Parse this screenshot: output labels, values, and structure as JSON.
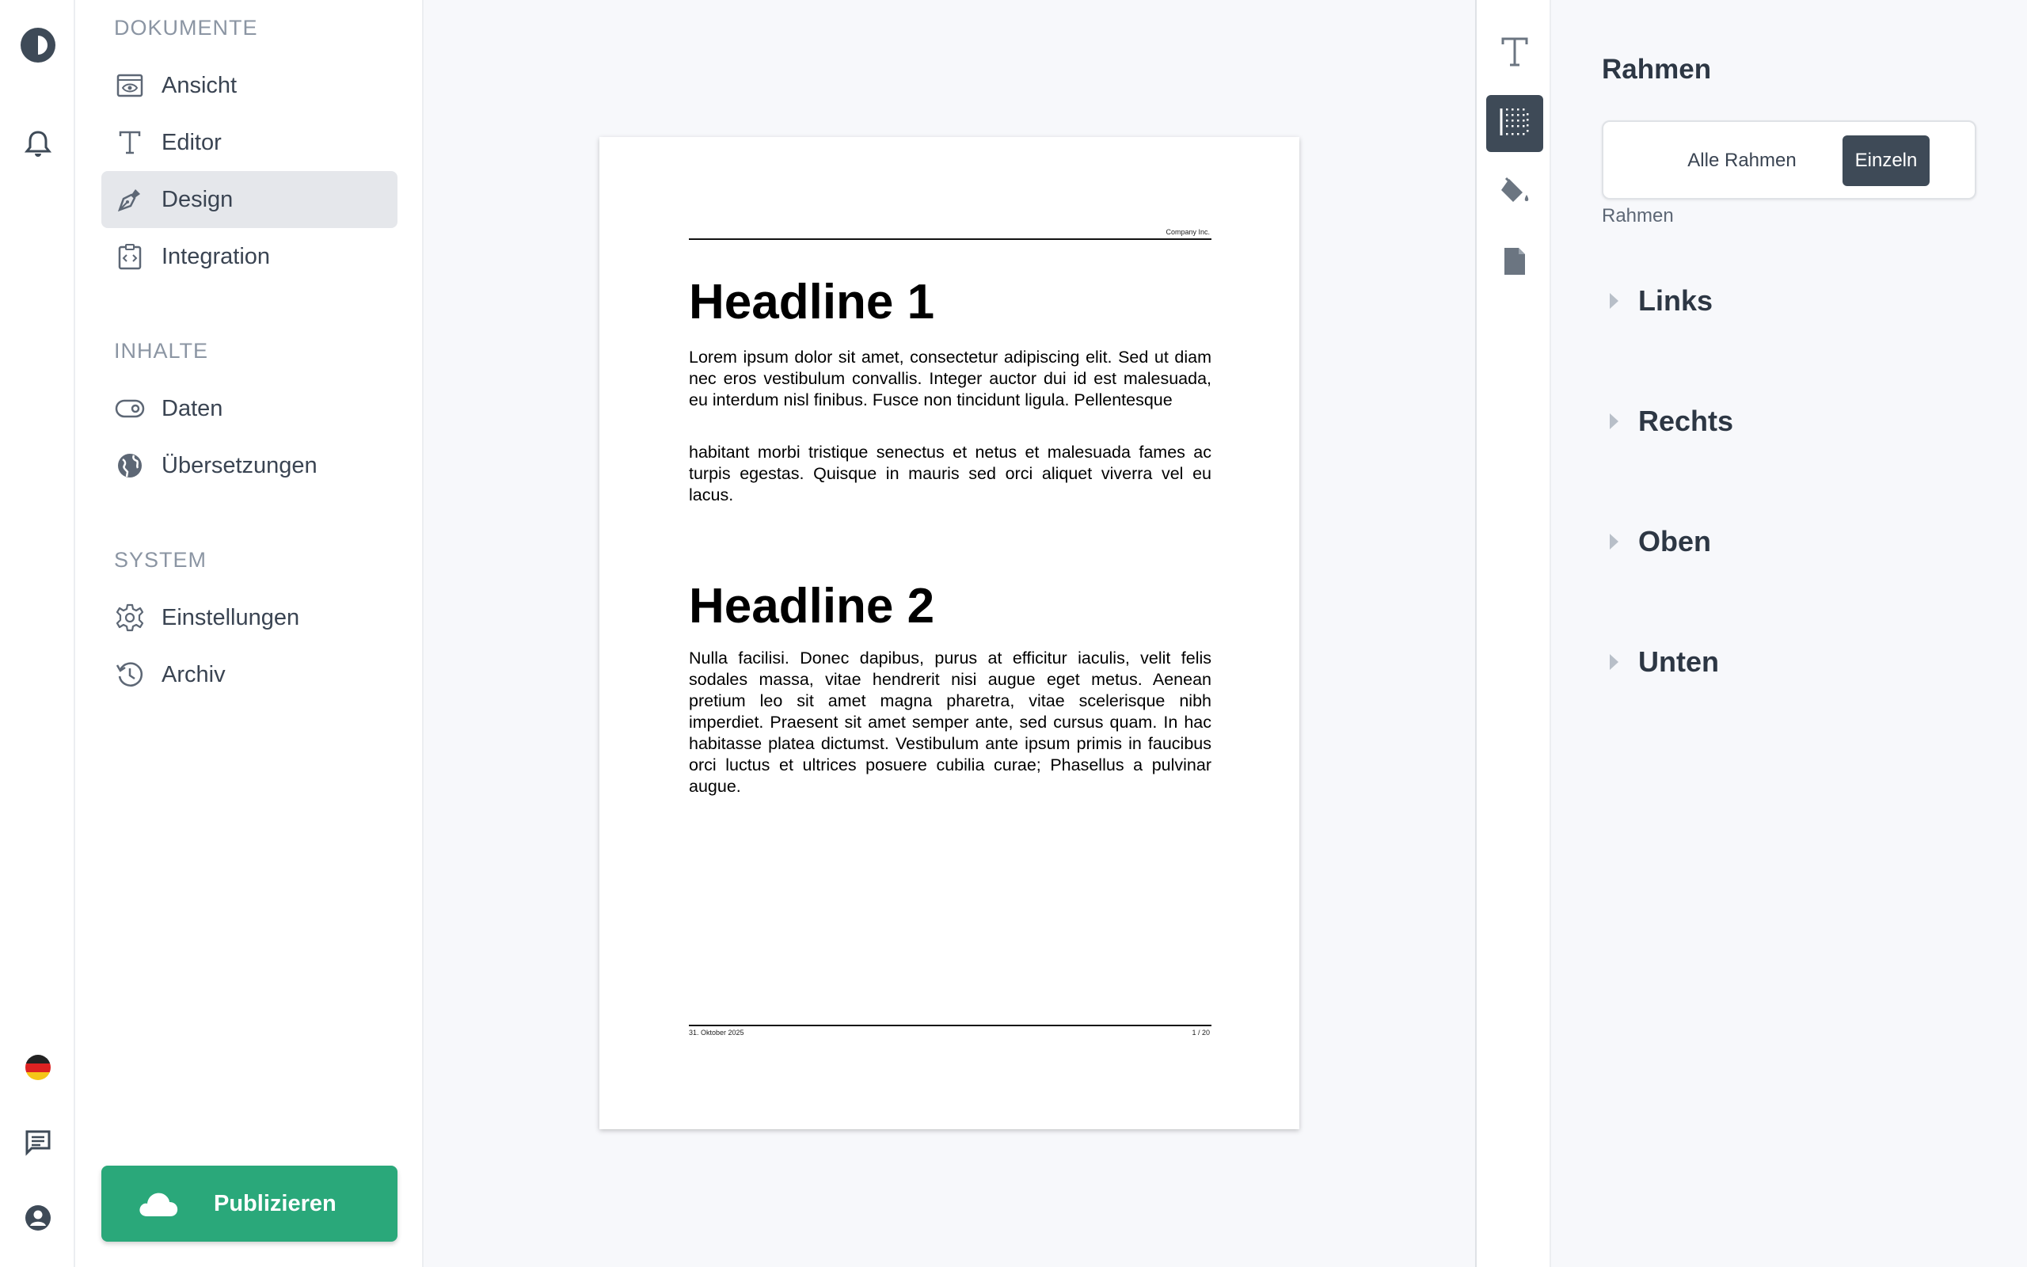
{
  "sidebar": {
    "sections": [
      {
        "title": "DOKUMENTE",
        "items": [
          {
            "label": "Ansicht",
            "icon": "eye-icon"
          },
          {
            "label": "Editor",
            "icon": "text-icon"
          },
          {
            "label": "Design",
            "icon": "pen-icon",
            "active": true
          },
          {
            "label": "Integration",
            "icon": "code-icon"
          }
        ]
      },
      {
        "title": "INHALTE",
        "items": [
          {
            "label": "Daten",
            "icon": "tag-icon"
          },
          {
            "label": "Übersetzungen",
            "icon": "globe-icon"
          }
        ]
      },
      {
        "title": "SYSTEM",
        "items": [
          {
            "label": "Einstellungen",
            "icon": "gear-icon"
          },
          {
            "label": "Archiv",
            "icon": "history-icon"
          }
        ]
      }
    ],
    "publish_label": "Publizieren"
  },
  "document": {
    "header_company": "Company Inc.",
    "headline1": "Headline 1",
    "para1": "Lorem ipsum dolor sit amet, consectetur adipiscing elit. Sed ut diam nec eros vestibulum convallis. Integer auctor dui id est malesuada, eu interdum nisl finibus. Fusce non tincidunt ligula. Pellentesque",
    "para2": "habitant morbi tristique senectus et netus et malesuada fames ac turpis egestas. Quisque in mauris sed orci aliquet viverra vel eu lacus.",
    "headline2": "Headline 2",
    "para3": "Nulla facilisi. Donec dapibus, purus at efficitur iaculis, velit felis sodales massa, vitae hendrerit nisi augue eget metus. Aenean pretium leo sit amet magna pharetra, vitae scelerisque nibh imperdiet. Praesent sit amet semper ante, sed cursus quam. In hac habitasse platea dictumst. Vestibulum ante ipsum primis in faucibus orci luctus et ultrices posuere cubilia curae; Phasellus a pulvinar augue.",
    "footer_date": "31. Oktober 2025",
    "footer_page": "1 / 20"
  },
  "panel": {
    "title": "Rahmen",
    "segment": {
      "all_label": "Alle Rahmen",
      "single_label": "Einzeln",
      "selected": "Einzeln"
    },
    "sublabel": "Rahmen",
    "accordions": [
      "Links",
      "Rechts",
      "Oben",
      "Unten"
    ]
  },
  "colors": {
    "accent": "#2aa87a",
    "dark": "#3e4a57"
  }
}
